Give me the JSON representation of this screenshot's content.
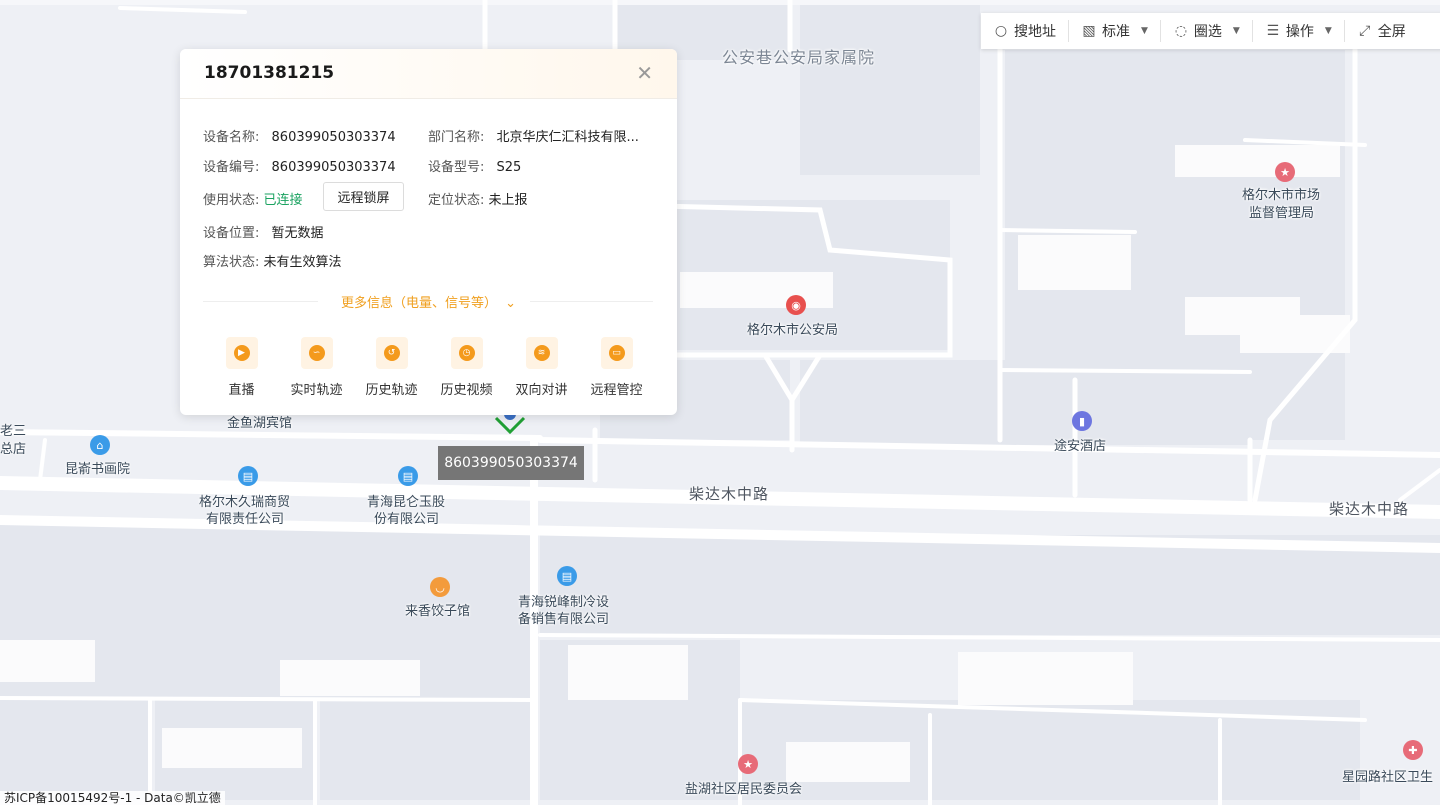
{
  "toolbar": {
    "search": "搜地址",
    "standard": "标准",
    "circle_select": "圈选",
    "operation": "操作",
    "fullscreen": "全屏"
  },
  "popup": {
    "title": "18701381215",
    "fields": {
      "device_name_label": "设备名称:",
      "device_name": "860399050303374",
      "dept_label": "部门名称:",
      "dept": "北京华庆仁汇科技有限...",
      "device_no_label": "设备编号:",
      "device_no": "860399050303374",
      "model_label": "设备型号:",
      "model": "S25",
      "use_status_label": "使用状态:",
      "use_status": "已连接",
      "lock_button": "远程锁屏",
      "locate_status_label": "定位状态:",
      "locate_status": "未上报",
      "location_label": "设备位置:",
      "location": "暂无数据",
      "algo_label": "算法状态:",
      "algo": "未有生效算法"
    },
    "more_info": "更多信息（电量、信号等）",
    "actions": [
      "直播",
      "实时轨迹",
      "历史轨迹",
      "历史视频",
      "双向对讲",
      "远程管控"
    ]
  },
  "marker_tooltip": "860399050303374",
  "map": {
    "labels": {
      "gongan_xiang": "公安巷公安局家属院",
      "market_1": "格尔木市市场",
      "market_2": "监督管理局",
      "police": "格尔木市公安局",
      "tuan_hotel": "途安酒店",
      "jinyuhu": "金鱼湖宾馆",
      "lao_san_1": "老三",
      "lao_san_2": "总店",
      "kunlun_book": "昆嵛书画院",
      "jiurui_1": "格尔木久瑞商贸",
      "jiurui_2": "有限责任公司",
      "kunlun_jade_1": "青海昆仑玉股",
      "kunlun_jade_2": "份有限公司",
      "road_1": "柴达木中路",
      "road_2": "柴达木中路",
      "laixiang": "来香饺子馆",
      "ruifeng_1": "青海锐峰制冷设",
      "ruifeng_2": "备销售有限公司",
      "yanhu": "盐湖社区居民委员会",
      "xingyuan": "星园路社区卫生"
    }
  },
  "footer": "苏ICP备10015492号-1 - Data©凯立德"
}
